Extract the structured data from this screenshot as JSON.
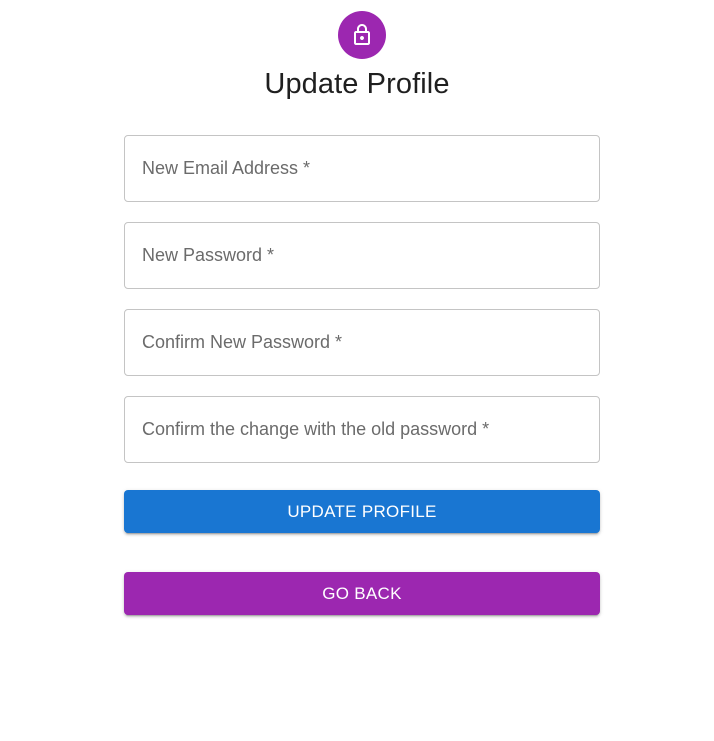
{
  "header": {
    "icon": "lock-icon",
    "title": "Update Profile"
  },
  "form": {
    "fields": [
      {
        "placeholder": "New Email Address *",
        "value": ""
      },
      {
        "placeholder": "New Password *",
        "value": ""
      },
      {
        "placeholder": "Confirm New Password *",
        "value": ""
      },
      {
        "placeholder": "Confirm the change with the old password *",
        "value": ""
      }
    ]
  },
  "buttons": {
    "update_label": "UPDATE PROFILE",
    "back_label": "GO BACK"
  },
  "colors": {
    "accent_purple": "#9c27b0",
    "primary_blue": "#1976d2"
  }
}
